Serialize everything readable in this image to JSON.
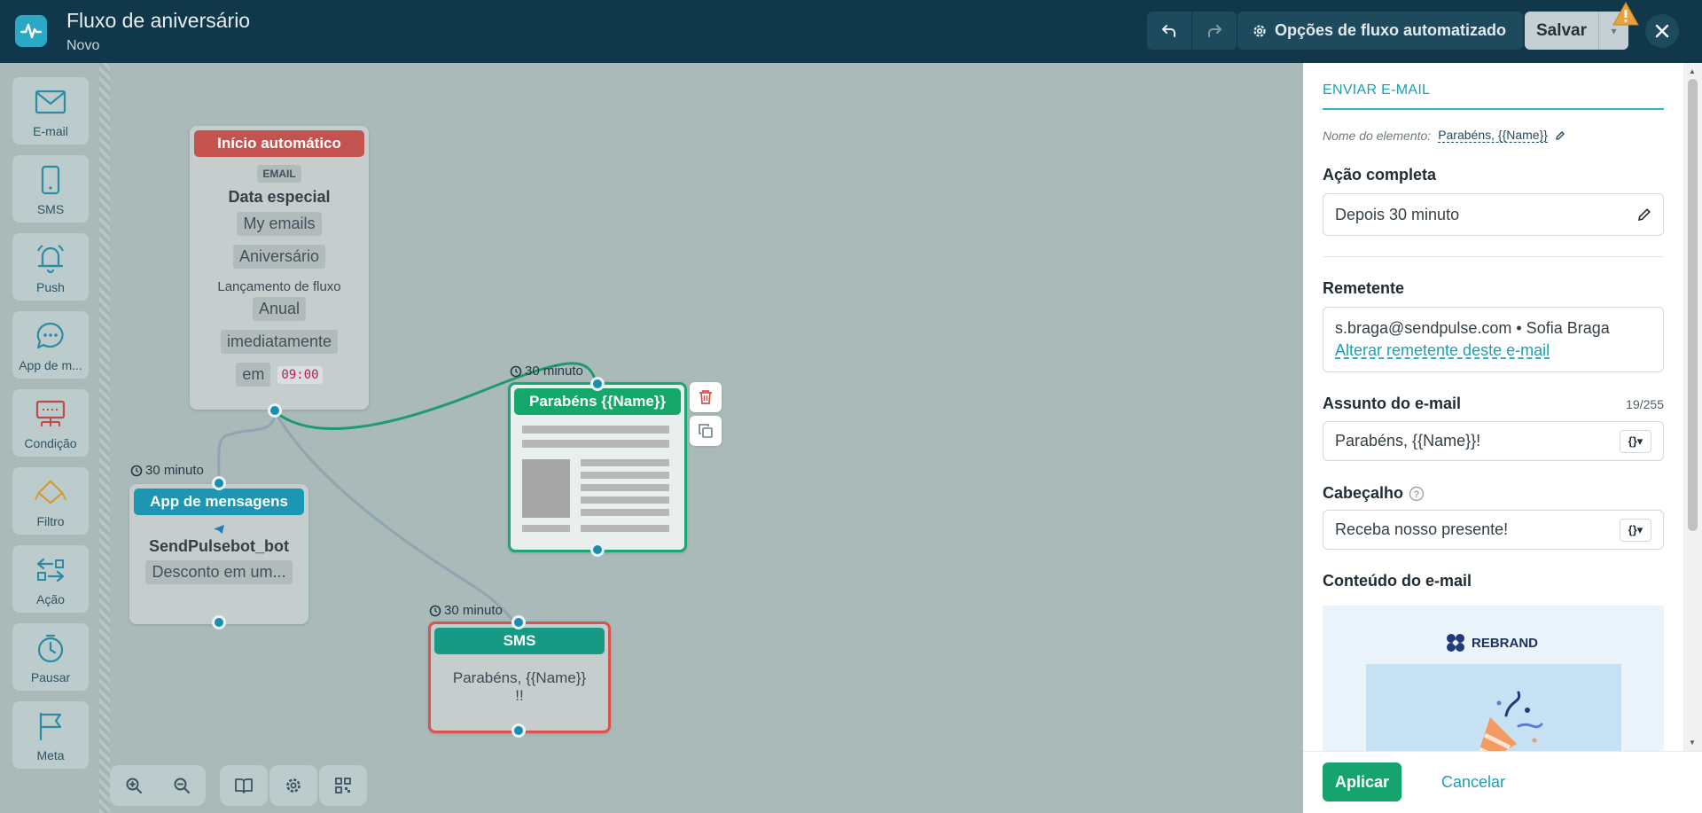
{
  "header": {
    "title": "Fluxo de aniversário",
    "subtitle": "Novo",
    "options_label": "Opções de fluxo automatizado",
    "save_label": "Salvar"
  },
  "sidebar": {
    "items": [
      {
        "label": "E-mail",
        "icon": "envelope-icon"
      },
      {
        "label": "SMS",
        "icon": "phone-icon"
      },
      {
        "label": "Push",
        "icon": "bell-icon"
      },
      {
        "label": "App de m...",
        "icon": "chat-icon"
      },
      {
        "label": "Condição",
        "icon": "condition-icon"
      },
      {
        "label": "Filtro",
        "icon": "filter-icon"
      },
      {
        "label": "Ação",
        "icon": "action-icon"
      },
      {
        "label": "Pausar",
        "icon": "timer-icon"
      },
      {
        "label": "Meta",
        "icon": "flag-icon"
      }
    ]
  },
  "canvas": {
    "start_node": {
      "header": "Início automático",
      "channel": "EMAIL",
      "title": "Data especial",
      "list": "My emails",
      "event": "Aniversário",
      "launch_label": "Lançamento de fluxo",
      "frequency": "Anual",
      "timing": "imediatamente",
      "at_label": "em",
      "time": "09:00"
    },
    "messenger_node": {
      "delay": "30 minuto",
      "header": "App de mensagens",
      "bot": "SendPulsebot_bot",
      "text": "Desconto em um..."
    },
    "email_node": {
      "delay": "30 minuto",
      "header": "Parabéns {{Name}}"
    },
    "sms_node": {
      "delay": "30 minuto",
      "header": "SMS",
      "text": "Parabéns, {{Name}} !!"
    }
  },
  "panel": {
    "title": "ENVIAR E-MAIL",
    "element_name_label": "Nome do elemento:",
    "element_name_value": "Parabéns, {{Name}}",
    "complete_action_label": "Ação completa",
    "complete_action_value": "Depois 30 minuto",
    "sender_label": "Remetente",
    "sender_value": "s.braga@sendpulse.com • Sofia Braga",
    "sender_change_link": "Alterar remetente deste e-mail",
    "subject_label": "Assunto do e-mail",
    "subject_count": "19/255",
    "subject_value": "Parabéns, {{Name}}!",
    "preheader_label": "Cabeçalho",
    "preheader_value": "Receba nosso presente!",
    "content_label": "Conteúdo do e-mail",
    "preview_brand": "REBRAND",
    "apply_label": "Aplicar",
    "cancel_label": "Cancelar"
  },
  "colors": {
    "topbar": "#10384a",
    "accent": "#1d9eb3",
    "start_header": "#c4524f",
    "email_header": "#16a86a",
    "sms_header": "#169a85",
    "messenger_header": "#1b97b3",
    "apply": "#15a46d"
  }
}
